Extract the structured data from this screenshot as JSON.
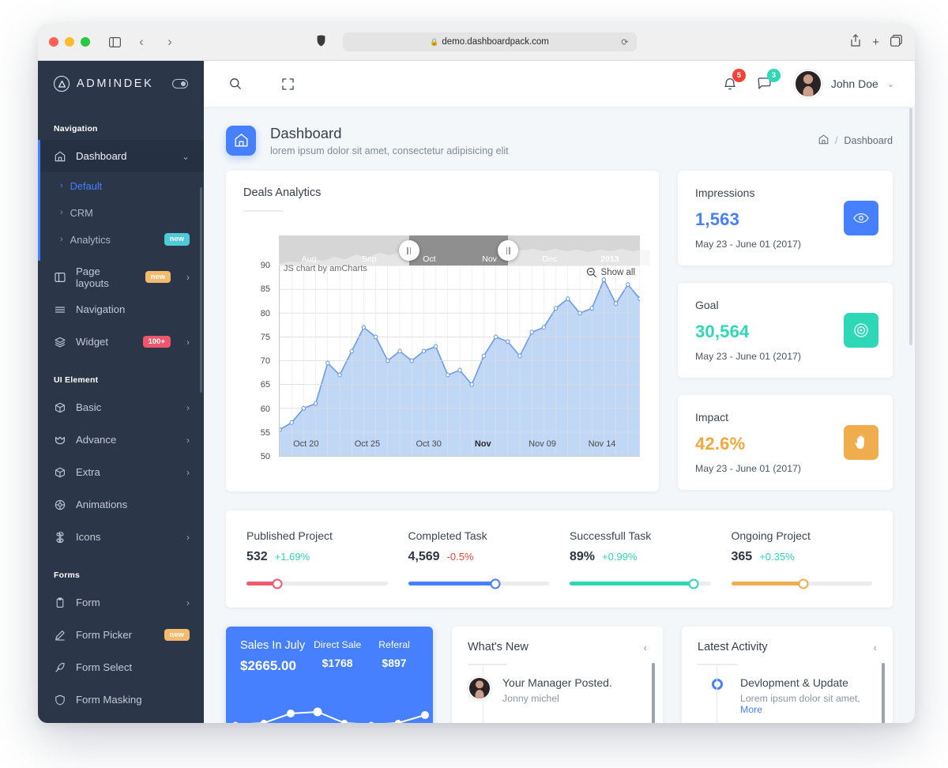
{
  "browser": {
    "url": "demo.dashboardpack.com",
    "lock_icon": "lock-icon",
    "reload_icon": "reload-icon",
    "sidebar_toggle_icon": "sidebar-toggle-icon",
    "back_icon": "chevron-left-icon",
    "forward_icon": "chevron-right-icon",
    "shield_icon": "privacy-shield-icon",
    "share_icon": "share-icon",
    "new_tab_icon": "plus-icon",
    "tabs_icon": "tab-overview-icon"
  },
  "sidebar": {
    "brand": "ADMINDEK",
    "sections": [
      {
        "caption": "Navigation",
        "items": [
          {
            "label": "Dashboard",
            "icon": "home-icon",
            "active": true,
            "chevron": "chevron-down-icon",
            "children": [
              {
                "label": "Default",
                "active": true,
                "arrow": "chevron-right-icon"
              },
              {
                "label": "CRM",
                "active": false,
                "arrow": "chevron-right-icon"
              },
              {
                "label": "Analytics",
                "active": false,
                "arrow": "chevron-right-icon",
                "badge": "new",
                "badge_color": "cyan"
              }
            ]
          },
          {
            "label": "Page layouts",
            "icon": "layout-icon",
            "badge": "new",
            "badge_color": "amber",
            "chevron": "chevron-right-icon"
          },
          {
            "label": "Navigation",
            "icon": "menu-icon"
          },
          {
            "label": "Widget",
            "icon": "layers-icon",
            "badge": "100+",
            "badge_color": "pink",
            "chevron": "chevron-right-icon"
          }
        ]
      },
      {
        "caption": "UI Element",
        "items": [
          {
            "label": "Basic",
            "icon": "box-icon",
            "chevron": "chevron-right-icon"
          },
          {
            "label": "Advance",
            "icon": "crown-icon",
            "chevron": "chevron-right-icon"
          },
          {
            "label": "Extra",
            "icon": "package-icon",
            "chevron": "chevron-right-icon"
          },
          {
            "label": "Animations",
            "icon": "globe-icon"
          },
          {
            "label": "Icons",
            "icon": "command-icon",
            "chevron": "chevron-right-icon"
          }
        ]
      },
      {
        "caption": "Forms",
        "items": [
          {
            "label": "Form",
            "icon": "clipboard-icon",
            "chevron": "chevron-right-icon"
          },
          {
            "label": "Form Picker",
            "icon": "pen-icon",
            "badge": "new",
            "badge_color": "amber"
          },
          {
            "label": "Form Select",
            "icon": "feather-icon"
          },
          {
            "label": "Form Masking",
            "icon": "shield-icon"
          }
        ]
      }
    ]
  },
  "topbar": {
    "search_icon": "search-icon",
    "fullscreen_icon": "fullscreen-icon",
    "bell_icon": "bell-icon",
    "bell_count": "5",
    "message_icon": "message-icon",
    "message_count": "3",
    "user_name": "John Doe",
    "user_caret": "chevron-down-icon",
    "avatar": "user-avatar"
  },
  "page": {
    "icon": "home-icon",
    "title": "Dashboard",
    "subtitle": "lorem ipsum dolor sit amet, consectetur adipisicing elit",
    "breadcrumb": {
      "home_icon": "home-icon",
      "separator": "/",
      "current": "Dashboard"
    }
  },
  "deals": {
    "title": "Deals Analytics",
    "credit": "JS chart by amCharts",
    "show_all": "Show all",
    "zoom_out_icon": "zoom-out-icon",
    "range_months": [
      "Aug",
      "Sep",
      "Oct",
      "Nov",
      "Dec",
      "2013"
    ]
  },
  "chart_data": {
    "type": "area",
    "title": "Deals Analytics",
    "xlabel": "",
    "ylabel": "",
    "ylim": [
      50,
      90
    ],
    "yticks": [
      50,
      55,
      60,
      65,
      70,
      75,
      80,
      85,
      90
    ],
    "xtick_labels": [
      "Oct 20",
      "Oct 25",
      "Oct 30",
      "Nov",
      "Nov 09",
      "Nov 14"
    ],
    "grid": true,
    "legend": "none",
    "line_color": "#6b9ae8",
    "fill_color": "#b6d0f5",
    "series": [
      {
        "name": "Deals",
        "values": [
          55.5,
          57,
          60,
          61,
          69.5,
          67,
          72,
          77,
          75,
          70,
          72,
          70,
          72,
          73,
          67,
          68,
          65,
          71,
          75,
          74,
          71,
          76,
          77,
          81,
          83,
          80,
          81,
          87,
          82,
          86,
          83
        ]
      }
    ],
    "range_selector": {
      "months": [
        "Aug",
        "Sep",
        "Oct",
        "Nov",
        "Dec",
        "2013"
      ],
      "selected_from_pct": 36,
      "selected_to_pct": 63.5
    }
  },
  "stats": [
    {
      "label": "Impressions",
      "value": "1,563",
      "date": "May 23 - June 01 (2017)",
      "color": "#4680ff",
      "badge_color": "#4680ff",
      "icon": "eye-icon"
    },
    {
      "label": "Goal",
      "value": "30,564",
      "date": "May 23 - June 01 (2017)",
      "color": "#2ed8b6",
      "badge_color": "#2ed8b6",
      "icon": "target-icon"
    },
    {
      "label": "Impact",
      "value": "42.6%",
      "date": "May 23 - June 01 (2017)",
      "color": "#f4a83c",
      "badge_color": "#f0ad4e",
      "icon": "hand-icon"
    }
  ],
  "progress": [
    {
      "title": "Published Project",
      "value": "532",
      "delta": "+1.69%",
      "delta_color": "#2ed8b6",
      "bar_color": "#ef5a6f",
      "percent": 22
    },
    {
      "title": "Completed Task",
      "value": "4,569",
      "delta": "-0.5%",
      "delta_color": "#f44236",
      "bar_color": "#4680ff",
      "percent": 62
    },
    {
      "title": "Successfull Task",
      "value": "89%",
      "delta": "+0.99%",
      "delta_color": "#2ed8b6",
      "bar_color": "#2ed8b6",
      "percent": 88
    },
    {
      "title": "Ongoing Project",
      "value": "365",
      "delta": "+0.35%",
      "delta_color": "#2ed8b6",
      "bar_color": "#f0ad4e",
      "percent": 51
    }
  ],
  "sales": {
    "title": "Sales In July",
    "amount": "$2665.00",
    "columns": [
      {
        "label": "Direct Sale",
        "value": "$1768"
      },
      {
        "label": "Referal",
        "value": "$897"
      }
    ]
  },
  "whats_new": {
    "title": "What's New",
    "nav_icon": "chevron-left-icon",
    "items": [
      {
        "title": "Your Manager Posted.",
        "subtitle": "Jonny michel",
        "avatar": "user-avatar"
      }
    ]
  },
  "latest_activity": {
    "title": "Latest Activity",
    "nav_icon": "chevron-left-icon",
    "items": [
      {
        "title": "Devlopment & Update",
        "subtitle": "Lorem ipsum dolor sit amet, ",
        "more": "More"
      }
    ]
  }
}
